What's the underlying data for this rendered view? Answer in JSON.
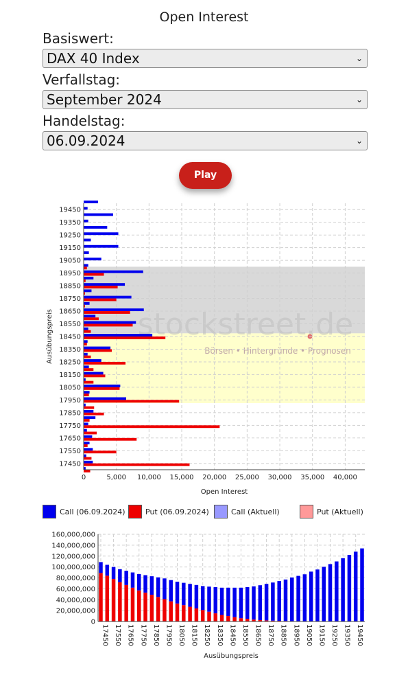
{
  "page": {
    "title": "Open Interest",
    "underlying_label": "Basiswert:",
    "underlying_value": "DAX 40 Index",
    "expiry_label": "Verfallstag:",
    "expiry_value": "September 2024",
    "tradeday_label": "Handelstag:",
    "tradeday_value": "06.09.2024",
    "play_label": "Play"
  },
  "watermark": {
    "logo_text": "stockstreet.de",
    "tagline": "Börsen • Hintergründe • Prognosen"
  },
  "colors": {
    "call": "#0000ee",
    "put": "#ee0000",
    "call_current": "#9999ff",
    "put_current": "#ff9999",
    "band_gray": "#d9d9d9",
    "band_yellow": "#ffffcc"
  },
  "chart_data": [
    {
      "type": "bar",
      "orientation": "horizontal",
      "xlabel": "Open Interest",
      "ylabel": "Ausübungspreis",
      "xlim": [
        0,
        43000
      ],
      "x_ticks": [
        "0",
        "5,000",
        "10,000",
        "15,000",
        "20,000",
        "25,000",
        "30,000",
        "35,000",
        "40,000"
      ],
      "y_tick_labels": [
        "19450",
        "19350",
        "19250",
        "19150",
        "19050",
        "18950",
        "18850",
        "18750",
        "18650",
        "18550",
        "18450",
        "18350",
        "18250",
        "18150",
        "18050",
        "17950",
        "17850",
        "17750",
        "17650",
        "17550",
        "17450"
      ],
      "grid": true,
      "shaded_ranges": [
        {
          "color": "gray",
          "from": 19000,
          "to": 18475
        },
        {
          "color": "yellow",
          "from": 18475,
          "to": 17925
        }
      ],
      "categories": [
        19500,
        19450,
        19400,
        19350,
        19300,
        19250,
        19200,
        19150,
        19100,
        19050,
        19000,
        18950,
        18900,
        18850,
        18800,
        18750,
        18700,
        18650,
        18600,
        18550,
        18500,
        18450,
        18400,
        18350,
        18300,
        18250,
        18200,
        18150,
        18100,
        18050,
        18000,
        17950,
        17900,
        17850,
        17800,
        17750,
        17700,
        17650,
        17600,
        17550,
        17500,
        17450,
        17400
      ],
      "series": [
        {
          "name": "Call (06.09.2024)",
          "values": [
            2200,
            600,
            4500,
            700,
            3600,
            5300,
            1100,
            5300,
            800,
            2700,
            700,
            9100,
            1500,
            6300,
            1200,
            7300,
            900,
            9200,
            1800,
            8000,
            700,
            10500,
            600,
            4100,
            600,
            2700,
            800,
            3000,
            300,
            5600,
            900,
            6500,
            300,
            1500,
            1800,
            700,
            500,
            1300,
            900,
            1400,
            400,
            1400,
            300
          ]
        },
        {
          "name": "Put (06.09.2024)",
          "values": [
            0,
            0,
            0,
            0,
            0,
            0,
            0,
            0,
            0,
            0,
            500,
            3100,
            300,
            5200,
            200,
            5000,
            200,
            7100,
            2300,
            7500,
            1100,
            12500,
            500,
            4300,
            1100,
            6400,
            1500,
            3300,
            1500,
            5500,
            800,
            14600,
            1600,
            3100,
            900,
            20800,
            2000,
            8100,
            600,
            5000,
            1200,
            16200,
            1000
          ]
        }
      ]
    },
    {
      "type": "bar",
      "xlabel": "Ausübungspreis",
      "ylabel": "",
      "ylim": [
        0,
        160000000
      ],
      "y_ticks": [
        "0",
        "20,000,000",
        "40,000,000",
        "60,000,000",
        "80,000,000",
        "100,000,000",
        "120,000,000",
        "140,000,000",
        "160,000,000"
      ],
      "x_tick_labels": [
        "17450",
        "17550",
        "17650",
        "17750",
        "17850",
        "17950",
        "18050",
        "18150",
        "18250",
        "18350",
        "18450",
        "18550",
        "18650",
        "18750",
        "18850",
        "18950",
        "19050",
        "19150",
        "19250",
        "19350",
        "19450"
      ],
      "stacked": true,
      "categories": [
        17450,
        17500,
        17550,
        17600,
        17650,
        17700,
        17750,
        17800,
        17850,
        17900,
        17950,
        18000,
        18050,
        18100,
        18150,
        18200,
        18250,
        18300,
        18350,
        18400,
        18450,
        18500,
        18550,
        18600,
        18650,
        18700,
        18750,
        18800,
        18850,
        18900,
        18950,
        19000,
        19050,
        19100,
        19150,
        19200,
        19250,
        19300,
        19350,
        19400,
        19450,
        19500
      ],
      "series": [
        {
          "name": "Call",
          "values": [
            20000000,
            20000000,
            22000000,
            24000000,
            26000000,
            28000000,
            30000000,
            32000000,
            34000000,
            36000000,
            38000000,
            39000000,
            40000000,
            41000000,
            42000000,
            43000000,
            44000000,
            46000000,
            48000000,
            50000000,
            52000000,
            54000000,
            56000000,
            58000000,
            61000000,
            64000000,
            67000000,
            70000000,
            73000000,
            76000000,
            80000000,
            83000000,
            86000000,
            91000000,
            95000000,
            100000000,
            105000000,
            110000000,
            116000000,
            122000000,
            128000000,
            134000000
          ]
        },
        {
          "name": "Put",
          "values": [
            89000000,
            84000000,
            78000000,
            72000000,
            67000000,
            62000000,
            57000000,
            53000000,
            49000000,
            45000000,
            41000000,
            37000000,
            33000000,
            30000000,
            27000000,
            24000000,
            21000000,
            18000000,
            15000000,
            12000000,
            10000000,
            8000000,
            6000000,
            5000000,
            3500000,
            2500000,
            2000000,
            1500000,
            1200000,
            1000000,
            800000,
            700000,
            600000,
            500000,
            400000,
            300000,
            300000,
            200000,
            200000,
            100000,
            100000,
            100000
          ]
        }
      ]
    }
  ],
  "legend": [
    {
      "label": "Call (06.09.2024)",
      "color": "#0000ee"
    },
    {
      "label": "Put (06.09.2024)",
      "color": "#ee0000"
    },
    {
      "label": "Call (Aktuell)",
      "color": "#9999ff"
    },
    {
      "label": "Put (Aktuell)",
      "color": "#ff9999"
    }
  ]
}
